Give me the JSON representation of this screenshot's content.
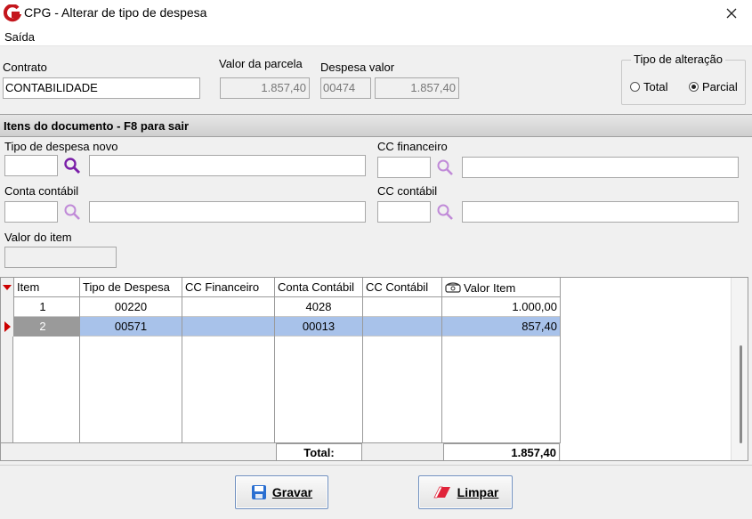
{
  "window": {
    "title": "CPG - Alterar de tipo de despesa"
  },
  "menu": {
    "items": [
      "Saída"
    ]
  },
  "header": {
    "contrato_label": "Contrato",
    "contrato_value": "CONTABILIDADE",
    "valor_parcela_label": "Valor da parcela",
    "valor_parcela_value": "1.857,40",
    "despesa_valor_label": "Despesa valor",
    "despesa_code": "00474",
    "despesa_value": "1.857,40"
  },
  "tipo_alteracao": {
    "title": "Tipo de alteração",
    "options": [
      "Total",
      "Parcial"
    ],
    "selected": "Parcial"
  },
  "section": {
    "title": "Itens do documento   - F8 para sair"
  },
  "fields": {
    "tipo_despesa_novo_label": "Tipo de despesa novo",
    "cc_financeiro_label": "CC financeiro",
    "conta_contabil_label": "Conta contábil",
    "cc_contabil_label": "CC contábil",
    "valor_item_label": "Valor do item"
  },
  "grid": {
    "columns": [
      "Item",
      "Tipo de Despesa",
      "CC Financeiro",
      "Conta Contábil",
      "CC Contábil",
      "Valor Item"
    ],
    "rows": [
      {
        "item": "1",
        "tipo": "00220",
        "cc_fin": "",
        "conta": "4028",
        "cc_cont": "",
        "valor": "1.000,00"
      },
      {
        "item": "2",
        "tipo": "00571",
        "cc_fin": "",
        "conta": "00013",
        "cc_cont": "",
        "valor": "857,40"
      }
    ],
    "total_label": "Total:",
    "total_value": "1.857,40"
  },
  "buttons": {
    "gravar": "Gravar",
    "limpar": "Limpar"
  },
  "colors": {
    "selection": "#a8c2ea",
    "search_icon": "#7a1fa8",
    "logo": "#c4161c",
    "indicator": "#cc0000"
  }
}
